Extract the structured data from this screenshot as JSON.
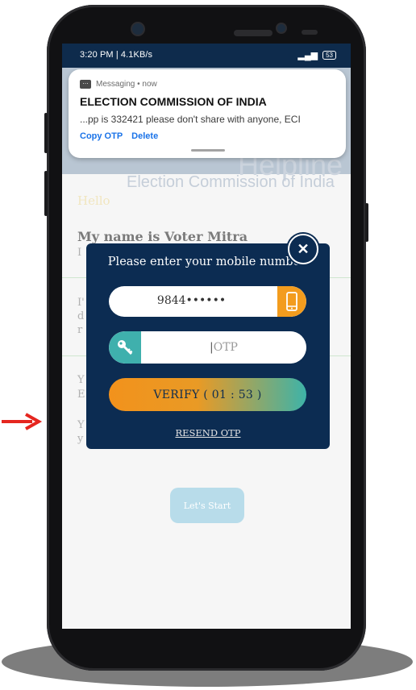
{
  "status_bar": {
    "time_speed": "3:20 PM | 4.1KB/s",
    "battery": "53"
  },
  "notification": {
    "app_line": "Messaging • now",
    "title": "ELECTION COMMISSION OF INDIA",
    "body": "...pp is 332421 please don't share with anyone, ECI",
    "actions": [
      "Copy OTP",
      "Delete"
    ]
  },
  "background": {
    "faded_title": "Helpline",
    "faded_subtitle": "Election Commission of India",
    "hello": "Hello",
    "intro_heading": "My name is Voter Mitra",
    "ghost_lines": [
      "I",
      "I'",
      "d",
      "r",
      "Y",
      "E",
      "Y",
      "y"
    ],
    "start_label": "Let's Start"
  },
  "dialog": {
    "title": "Please enter your mobile number.",
    "mobile_value": "9844••••••",
    "otp_placeholder": "OTP",
    "verify_label": "VERIFY ( 01 : 53 )",
    "resend_label": "RESEND OTP",
    "close_glyph": "✕"
  },
  "colors": {
    "navy": "#0c2c52",
    "orange": "#f39c1e",
    "teal": "#3fb0ad",
    "arrow": "#e5261f"
  },
  "icons": [
    "close-icon",
    "mobile-phone-icon",
    "key-icon",
    "arrow-right-icon",
    "messaging-icon"
  ]
}
